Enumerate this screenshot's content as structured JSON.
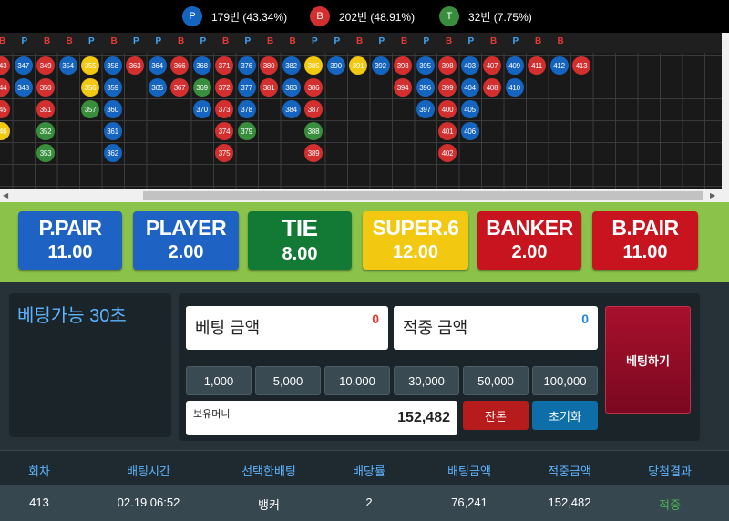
{
  "stats": [
    {
      "letter": "P",
      "text": "179번 (43.34%)",
      "color": "#1565c0"
    },
    {
      "letter": "B",
      "text": "202번 (48.91%)",
      "color": "#d32f2f"
    },
    {
      "letter": "T",
      "text": "32번 (7.75%)",
      "color": "#388e3c"
    }
  ],
  "road": {
    "header_letters": [
      "B",
      "P",
      "B",
      "B",
      "P",
      "B",
      "P",
      "P",
      "B",
      "P",
      "B",
      "P",
      "B",
      "B",
      "P",
      "P",
      "B",
      "P",
      "B",
      "P",
      "B",
      "P",
      "B",
      "P",
      "B",
      "B"
    ],
    "columns": [
      {
        "balls": [
          {
            "n": "343",
            "c": "B"
          },
          {
            "n": "344",
            "c": "B"
          },
          {
            "n": "345",
            "c": "B"
          },
          {
            "n": "346",
            "c": "Y"
          }
        ]
      },
      {
        "balls": [
          {
            "n": "347",
            "c": "P"
          },
          {
            "n": "348",
            "c": "P"
          }
        ]
      },
      {
        "balls": [
          {
            "n": "349",
            "c": "B"
          },
          {
            "n": "350",
            "c": "B"
          },
          {
            "n": "351",
            "c": "B"
          },
          {
            "n": "352",
            "c": "G"
          },
          {
            "n": "353",
            "c": "G"
          }
        ]
      },
      {
        "balls": [
          {
            "n": "354",
            "c": "P"
          }
        ]
      },
      {
        "balls": [
          {
            "n": "355",
            "c": "Y"
          },
          {
            "n": "356",
            "c": "Y"
          },
          {
            "n": "357",
            "c": "G"
          }
        ]
      },
      {
        "balls": [
          {
            "n": "358",
            "c": "P"
          },
          {
            "n": "359",
            "c": "P"
          },
          {
            "n": "360",
            "c": "P"
          },
          {
            "n": "361",
            "c": "P"
          },
          {
            "n": "362",
            "c": "P"
          }
        ]
      },
      {
        "balls": [
          {
            "n": "363",
            "c": "B"
          }
        ]
      },
      {
        "balls": [
          {
            "n": "364",
            "c": "P"
          },
          {
            "n": "365",
            "c": "P"
          }
        ]
      },
      {
        "balls": [
          {
            "n": "366",
            "c": "B"
          },
          {
            "n": "367",
            "c": "B"
          }
        ]
      },
      {
        "balls": [
          {
            "n": "368",
            "c": "P"
          },
          {
            "n": "369",
            "c": "G"
          },
          {
            "n": "370",
            "c": "P"
          }
        ]
      },
      {
        "balls": [
          {
            "n": "371",
            "c": "B"
          },
          {
            "n": "372",
            "c": "B"
          },
          {
            "n": "373",
            "c": "B"
          },
          {
            "n": "374",
            "c": "B"
          },
          {
            "n": "375",
            "c": "B"
          }
        ]
      },
      {
        "balls": [
          {
            "n": "376",
            "c": "P"
          },
          {
            "n": "377",
            "c": "P"
          },
          {
            "n": "378",
            "c": "P"
          },
          {
            "n": "379",
            "c": "G"
          }
        ]
      },
      {
        "balls": [
          {
            "n": "380",
            "c": "B"
          },
          {
            "n": "381",
            "c": "B"
          }
        ]
      },
      {
        "balls": [
          {
            "n": "382",
            "c": "P"
          },
          {
            "n": "383",
            "c": "P"
          },
          {
            "n": "384",
            "c": "P"
          }
        ]
      },
      {
        "balls": [
          {
            "n": "385",
            "c": "Y"
          },
          {
            "n": "386",
            "c": "B"
          },
          {
            "n": "387",
            "c": "B"
          },
          {
            "n": "388",
            "c": "G"
          },
          {
            "n": "389",
            "c": "B"
          }
        ]
      },
      {
        "balls": [
          {
            "n": "390",
            "c": "P"
          }
        ]
      },
      {
        "balls": [
          {
            "n": "391",
            "c": "Y"
          }
        ]
      },
      {
        "balls": [
          {
            "n": "392",
            "c": "P"
          }
        ]
      },
      {
        "balls": [
          {
            "n": "393",
            "c": "B"
          },
          {
            "n": "394",
            "c": "B"
          }
        ]
      },
      {
        "balls": [
          {
            "n": "395",
            "c": "P"
          },
          {
            "n": "396",
            "c": "P"
          },
          {
            "n": "397",
            "c": "P"
          }
        ]
      },
      {
        "balls": [
          {
            "n": "398",
            "c": "B"
          },
          {
            "n": "399",
            "c": "B"
          },
          {
            "n": "400",
            "c": "B"
          },
          {
            "n": "401",
            "c": "B"
          },
          {
            "n": "402",
            "c": "B"
          }
        ]
      },
      {
        "balls": [
          {
            "n": "403",
            "c": "P"
          },
          {
            "n": "404",
            "c": "P"
          },
          {
            "n": "405",
            "c": "P"
          },
          {
            "n": "406",
            "c": "P"
          }
        ]
      },
      {
        "balls": [
          {
            "n": "407",
            "c": "B"
          },
          {
            "n": "408",
            "c": "B"
          }
        ]
      },
      {
        "balls": [
          {
            "n": "409",
            "c": "P"
          },
          {
            "n": "410",
            "c": "P"
          }
        ]
      },
      {
        "balls": [
          {
            "n": "411",
            "c": "B"
          }
        ]
      },
      {
        "balls": [
          {
            "n": "412",
            "c": "P"
          }
        ]
      },
      {
        "balls": [
          {
            "n": "413",
            "c": "B"
          }
        ]
      }
    ]
  },
  "ball_colors": {
    "P": "#1565c0",
    "B": "#d32f2f",
    "G": "#388e3c",
    "Y": "#f2c811"
  },
  "bets": [
    {
      "name": "P.PAIR",
      "odds": "11.00",
      "bg": "#1e63c4",
      "fg": "#ffffff"
    },
    {
      "name": "PLAYER",
      "odds": "2.00",
      "bg": "#1e63c4",
      "fg": "#ffffff"
    },
    {
      "name": "TIE",
      "odds": "8.00",
      "bg": "#137a35",
      "fg": "#ffffff"
    },
    {
      "name": "SUPER.6",
      "odds": "12.00",
      "bg": "#f2c811",
      "fg": "#ffffff"
    },
    {
      "name": "BANKER",
      "odds": "2.00",
      "bg": "#c8141e",
      "fg": "#ffffff"
    },
    {
      "name": "B.PAIR",
      "odds": "11.00",
      "bg": "#c8141e",
      "fg": "#ffffff"
    }
  ],
  "timer": {
    "label": "베팅가능 30초"
  },
  "form": {
    "bet_amount_label": "베팅 금액",
    "bet_amount_value": "0",
    "win_amount_label": "적중 금액",
    "win_amount_value": "0",
    "amount_buttons": [
      "1,000",
      "5,000",
      "10,000",
      "30,000",
      "50,000",
      "100,000"
    ],
    "balance_label": "보유머니",
    "balance_value": "152,482",
    "remaining_button": "잔돈",
    "reset_button": "초기화",
    "bet_button": "베팅하기"
  },
  "history": {
    "headers": [
      "회차",
      "배팅시간",
      "선택한배팅",
      "배당률",
      "배팅금액",
      "적중금액",
      "당첨결과"
    ],
    "rows": [
      [
        "413",
        "02.19 06:52",
        "뱅커",
        "2",
        "76,241",
        "152,482",
        "적중"
      ]
    ]
  }
}
